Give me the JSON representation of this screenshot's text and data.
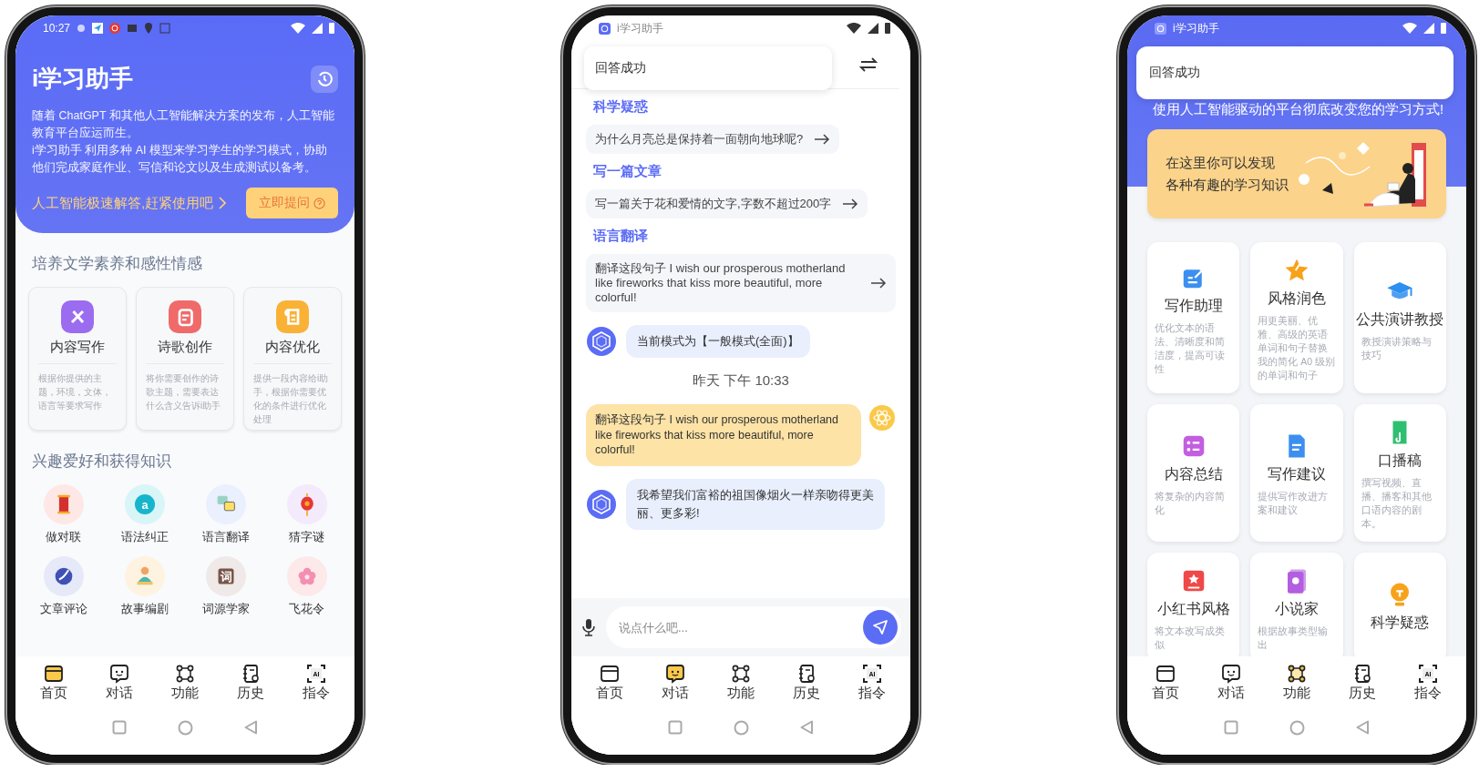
{
  "home_phone": {
    "status_bar": {
      "time": "10:27"
    },
    "header": {
      "title": "i学习助手",
      "paragraphs": [
        "随着 ChatGPT 和其他人工智能解决方案的发布，人工智能教育平台应运而生。",
        " i学习助手 利用多种 AI 模型来学习学生的学习模式，协助他们完成家庭作业、写信和论文以及生成测试以备考。"
      ],
      "promo": "人工智能极速解答,赶紧使用吧",
      "ask_button": "立即提问"
    },
    "literature_section": {
      "title": "培养文学素养和感性情感",
      "cards": [
        {
          "title": "内容写作",
          "description": "根据你提供的主题，环境，文体，语言等要求写作",
          "color": "#9b6cf0"
        },
        {
          "title": "诗歌创作",
          "description": "将你需要创作的诗歌主题，需要表达什么含义告诉i助手",
          "color": "#f06a6a"
        },
        {
          "title": "内容优化",
          "description": "提供一段内容给i助手，根据你需要优化的条件进行优化处理",
          "color": "#f9b236"
        }
      ]
    },
    "hobby_section": {
      "title": "兴趣爱好和获得知识",
      "items": [
        {
          "label": "做对联",
          "color": "#fde8e6"
        },
        {
          "label": "语法纠正",
          "color": "#d8f5f8",
          "icon_text": "a"
        },
        {
          "label": "语言翻译",
          "color": "#eaf0fd"
        },
        {
          "label": "猜字谜",
          "color": "#f3eafc"
        },
        {
          "label": "文章评论",
          "color": "#e6e9f7"
        },
        {
          "label": "故事编剧",
          "color": "#fdf3e0"
        },
        {
          "label": "词源学家",
          "color": "#efe9e7",
          "icon_text": "词"
        },
        {
          "label": "飞花令",
          "color": "#fde9e9"
        }
      ]
    },
    "tab_bar": [
      {
        "label": "首页",
        "selected": true
      },
      {
        "label": "对话",
        "selected": false
      },
      {
        "label": "功能",
        "selected": false
      },
      {
        "label": "历史",
        "selected": false
      },
      {
        "label": "指令",
        "selected": false,
        "icon_text": "AI"
      }
    ]
  },
  "chat_phone": {
    "status_bar": {
      "app_name": "i学习助手"
    },
    "toast": "回答成功",
    "suggestions": [
      {
        "title": "科学疑惑",
        "prompt": "为什么月亮总是保持着一面朝向地球呢?"
      },
      {
        "title": "写一篇文章",
        "prompt": "写一篇关于花和爱情的文字,字数不超过200字"
      },
      {
        "title": "语言翻译",
        "prompt": "翻译这段句子  I wish our prosperous motherland like fireworks that kiss more beautiful, more colorful!"
      }
    ],
    "messages": [
      {
        "kind": "bot",
        "text": "当前模式为【一般模式(全面)】"
      },
      {
        "kind": "time",
        "text": "昨天 下午 10:33"
      },
      {
        "kind": "user",
        "text": "翻译这段句子  I wish our prosperous motherland like fireworks that kiss more beautiful, more colorful!"
      },
      {
        "kind": "bot",
        "text": "我希望我们富裕的祖国像烟火一样亲吻得更美丽、更多彩!"
      }
    ],
    "input": {
      "placeholder": "说点什么吧..."
    },
    "tab_bar": [
      {
        "label": "首页",
        "selected": false
      },
      {
        "label": "对话",
        "selected": true
      },
      {
        "label": "功能",
        "selected": false
      },
      {
        "label": "历史",
        "selected": false
      },
      {
        "label": "指令",
        "selected": false,
        "icon_text": "AI"
      }
    ]
  },
  "features_phone": {
    "status_bar": {
      "app_name": "i学习助手"
    },
    "toast": "回答成功",
    "banner": "使用人工智能驱动的平台彻底改变您的学习方式!",
    "promo_lines": [
      "在这里你可以发现",
      "各种有趣的学习知识"
    ],
    "cards": [
      {
        "title": "写作助理",
        "description": "优化文本的语法、清晰度和简洁度，提高可读性",
        "color": "#3b8ff0"
      },
      {
        "title": "风格润色",
        "description": "用更美丽、优雅、高级的英语单词和句子替换我的简化 A0 级别的单词和句子",
        "color": "#f7a21b"
      },
      {
        "title": "公共演讲教授",
        "description": "教授演讲策略与技巧",
        "color": "#2d8ff0"
      },
      {
        "title": "内容总结",
        "description": "将复杂的内容简化",
        "color": "#c35ee0"
      },
      {
        "title": "写作建议",
        "description": "提供写作改进方案和建议",
        "color": "#3b8ff0"
      },
      {
        "title": "口播稿",
        "description": "撰写视频、直播、播客和其他口语内容的剧本。",
        "color": "#2fbf71"
      },
      {
        "title": "小红书风格",
        "description": "将文本改写成类似",
        "color": "#f04848"
      },
      {
        "title": "小说家",
        "description": "根据故事类型输出",
        "color": "#b35ee0"
      },
      {
        "title": "科学疑惑",
        "color": "#f7a21b"
      }
    ],
    "tab_bar": [
      {
        "label": "首页",
        "selected": false
      },
      {
        "label": "对话",
        "selected": false
      },
      {
        "label": "功能",
        "selected": true
      },
      {
        "label": "历史",
        "selected": false
      },
      {
        "label": "指令",
        "selected": false,
        "icon_text": "AI"
      }
    ]
  }
}
